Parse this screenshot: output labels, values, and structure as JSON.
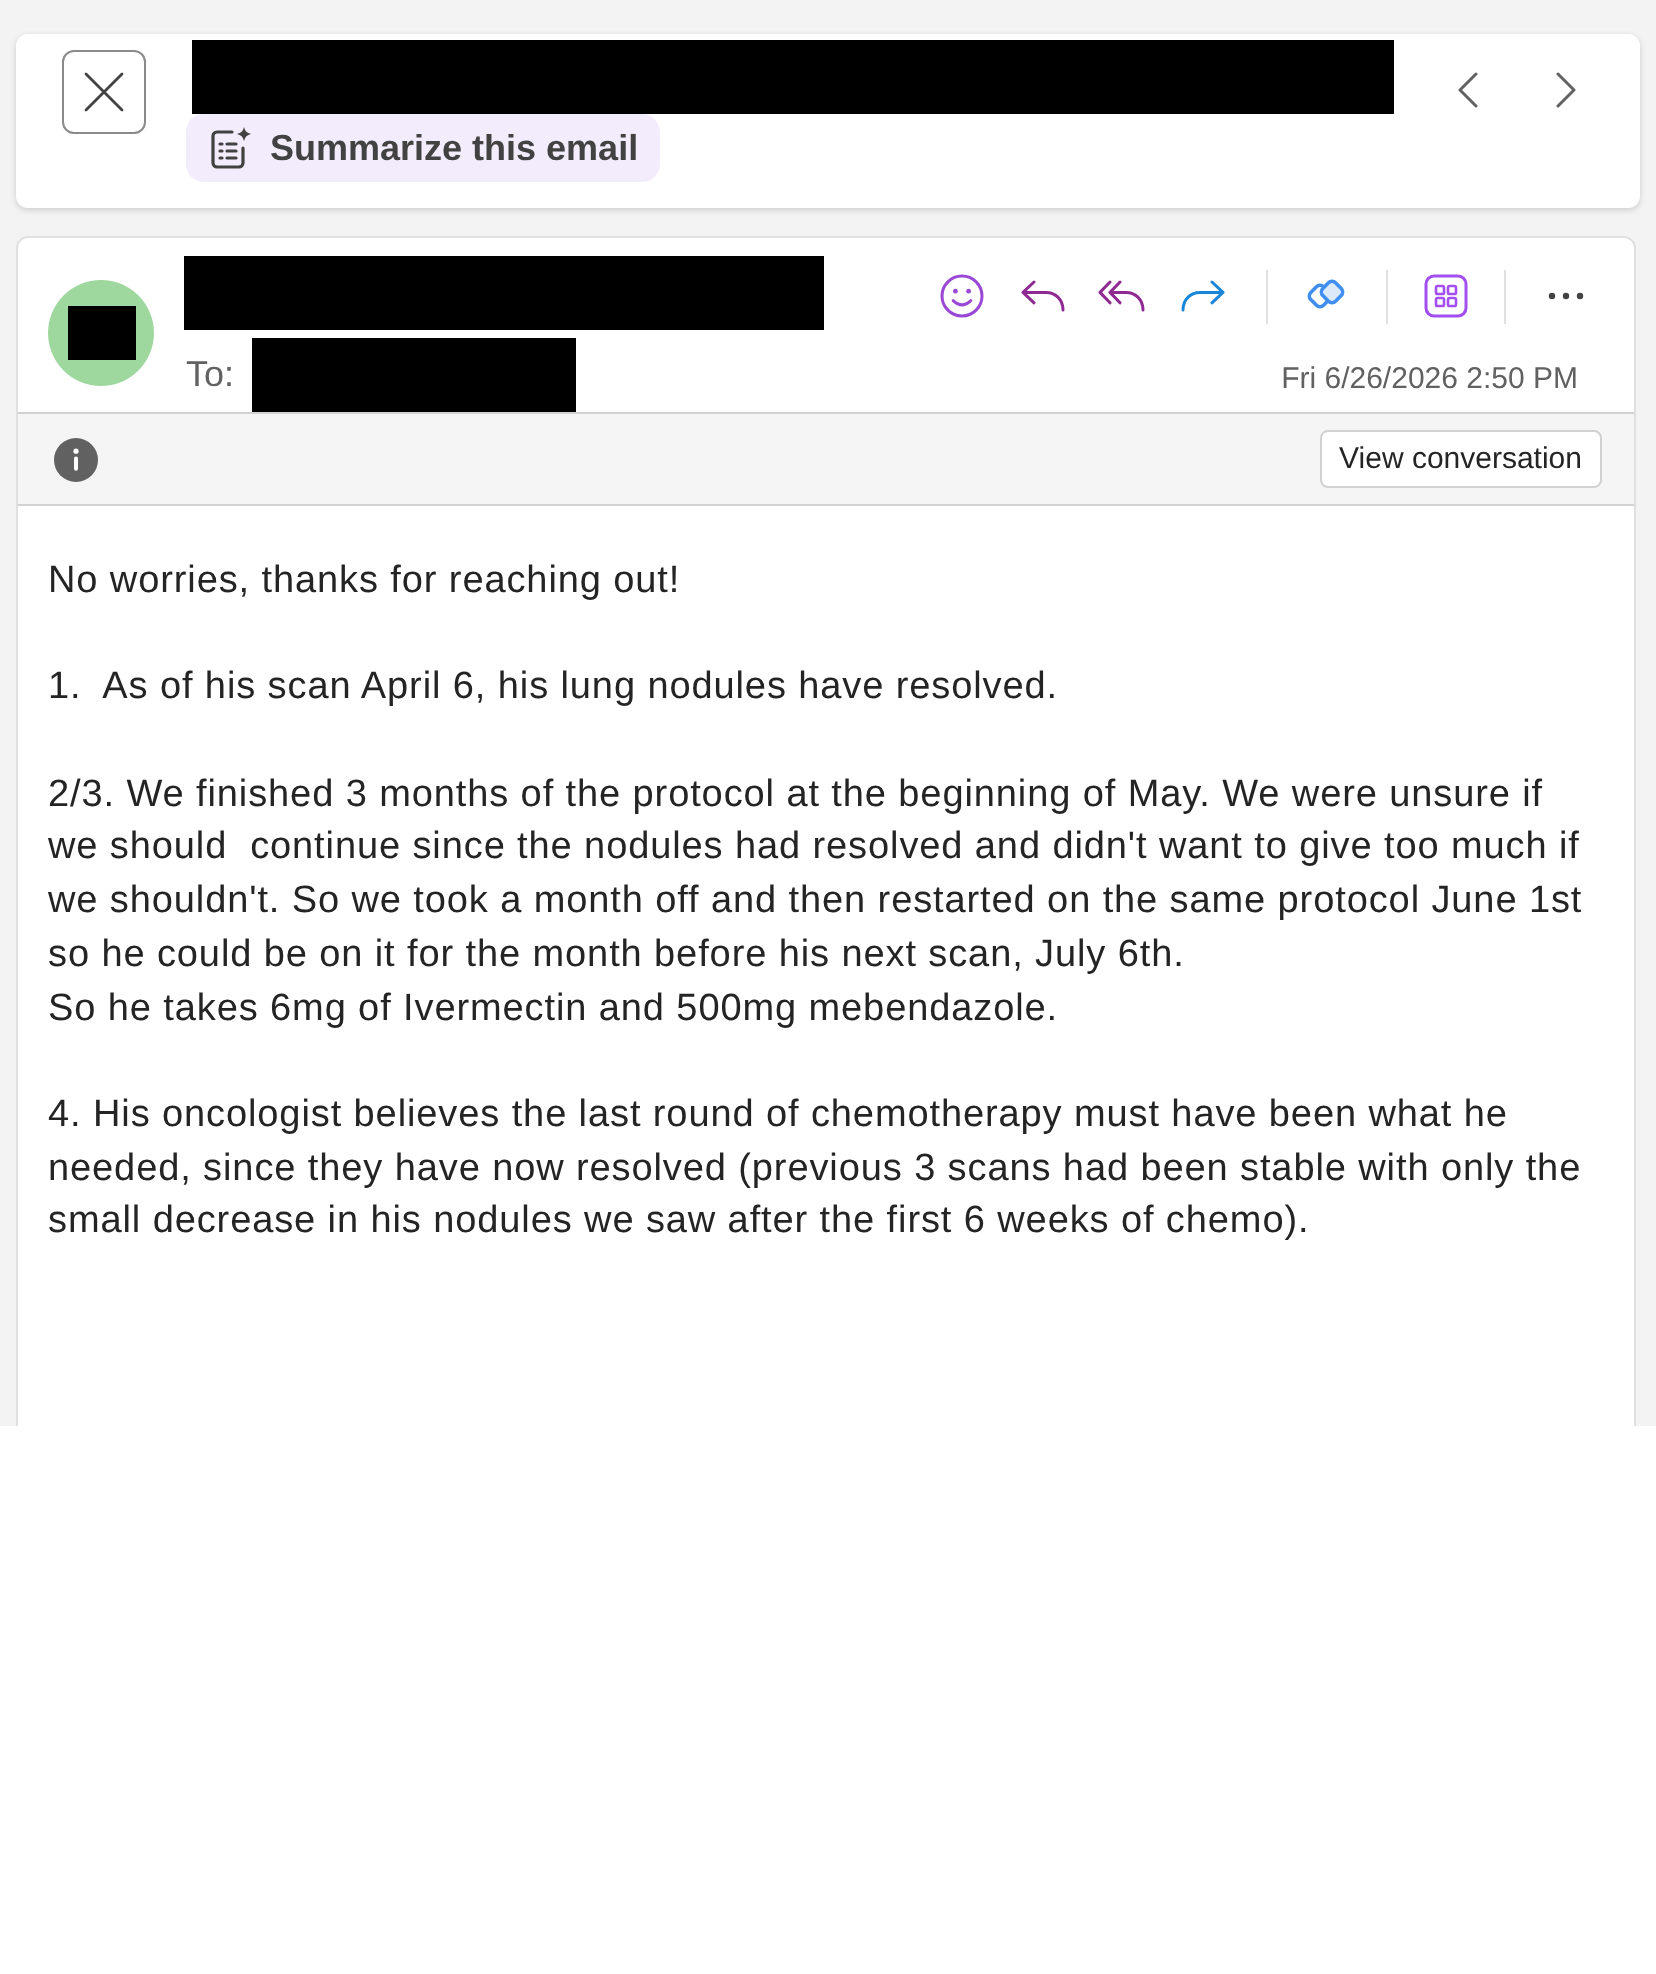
{
  "header": {
    "subject": {
      "redacted": true
    },
    "summarize_button": "Summarize this email"
  },
  "message": {
    "avatar": {
      "redacted": true
    },
    "sender": {
      "redacted": true
    },
    "to_label": "To:",
    "recipient": {
      "redacted": true
    },
    "date": "Fri 6/26/2026 2:50 PM",
    "view_conversation_button": "View conversation",
    "body": [
      {
        "lines": [
          "No worries, thanks for reaching out!"
        ]
      },
      {
        "lines": [
          "1.  As of his scan April 6, his lung nodules have resolved."
        ]
      },
      {
        "lines": [
          "2/3. We finished 3 months of the protocol at the beginning of May. We were unsure if",
          "we should  continue since the nodules had resolved and didn't want to give too much if",
          "we shouldn't. So we took a month off and then restarted on the same protocol June 1st",
          "so he could be on it for the month before his next scan, July 6th.",
          "So he takes 6mg of Ivermectin and 500mg mebendazole."
        ]
      },
      {
        "lines": [
          "4. His oncologist believes the last round of chemotherapy must have been what he",
          "needed, since they have now resolved (previous 3 scans had been stable with only the",
          "small decrease in his nodules we saw after the first 6 weeks of chemo)."
        ]
      }
    ]
  }
}
